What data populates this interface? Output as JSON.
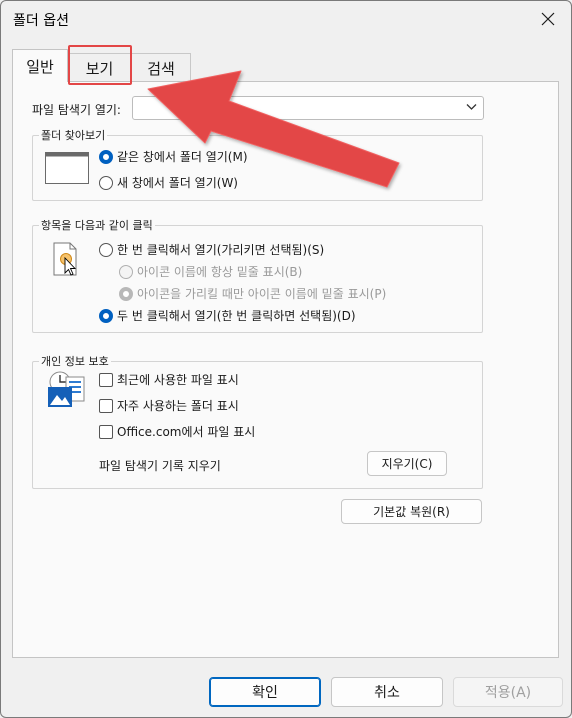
{
  "window": {
    "title": "폴더 옵션"
  },
  "tabs": [
    {
      "label": "일반",
      "active": true
    },
    {
      "label": "보기",
      "active": false
    },
    {
      "label": "검색",
      "active": false
    }
  ],
  "general": {
    "open_explorer_label": "파일 탐색기 열기:",
    "open_explorer_value": ""
  },
  "browse_folders": {
    "title": "폴더 찾아보기",
    "options": [
      {
        "label": "같은 창에서 폴더 열기(M)",
        "checked": true
      },
      {
        "label": "새 창에서 폴더 열기(W)",
        "checked": false
      }
    ]
  },
  "click_items": {
    "title": "항목을 다음과 같이 클릭",
    "single_click": "한 번 클릭해서 열기(가리키면 선택됨)(S)",
    "underline_always": "아이콘 이름에 항상 밑줄 표시(B)",
    "underline_hover": "아이콘을 가리킬 때만 아이콘 이름에 밑줄 표시(P)",
    "double_click": "두 번 클릭해서 열기(한 번 클릭하면 선택됨)(D)"
  },
  "privacy": {
    "title": "개인 정보 보호",
    "show_recent_files": "최근에 사용한 파일 표시",
    "show_frequent_folders": "자주 사용하는 폴더 표시",
    "show_office_files": "Office.com에서 파일 표시",
    "clear_history_label": "파일 탐색기 기록 지우기",
    "clear_button": "지우기(C)"
  },
  "restore_defaults": "기본값 복원(R)",
  "footer": {
    "ok": "확인",
    "cancel": "취소",
    "apply": "적용(A)"
  },
  "colors": {
    "accent": "#0060c0",
    "annotation": "#e34646"
  }
}
